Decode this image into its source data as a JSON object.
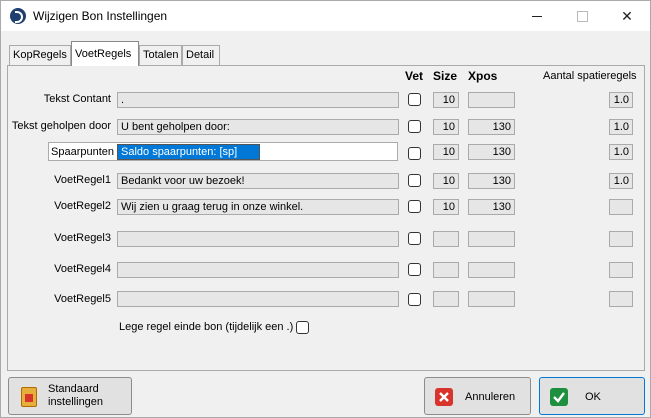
{
  "window": {
    "title": "Wijzigen Bon Instellingen"
  },
  "tabs": [
    {
      "label": "KopRegels"
    },
    {
      "label": "VoetRegels"
    },
    {
      "label": "Totalen"
    },
    {
      "label": "Detail"
    }
  ],
  "columns": {
    "vet": "Vet",
    "size": "Size",
    "xpos": "Xpos",
    "spacing": "Aantal spatieregels"
  },
  "rows": [
    {
      "label": "Tekst Contant",
      "text": ".",
      "size": "10",
      "xpos": "",
      "spacing": "1.0"
    },
    {
      "label": "Tekst geholpen door",
      "text": "U bent geholpen door:",
      "size": "10",
      "xpos": "130",
      "spacing": "1.0"
    },
    {
      "label": "Spaarpunten",
      "text": "Saldo spaarpunten: [sp]",
      "size": "10",
      "xpos": "130",
      "spacing": "1.0"
    },
    {
      "label": "VoetRegel1",
      "text": "Bedankt voor uw bezoek!",
      "size": "10",
      "xpos": "130",
      "spacing": "1.0"
    },
    {
      "label": "VoetRegel2",
      "text": "Wij zien u graag terug in onze winkel.",
      "size": "10",
      "xpos": "130",
      "spacing": ""
    },
    {
      "label": "VoetRegel3",
      "text": "",
      "size": "",
      "xpos": "",
      "spacing": ""
    },
    {
      "label": "VoetRegel4",
      "text": "",
      "size": "",
      "xpos": "",
      "spacing": ""
    },
    {
      "label": "VoetRegel5",
      "text": "",
      "size": "",
      "xpos": "",
      "spacing": ""
    }
  ],
  "options": {
    "lege_regel_label": "Lege regel einde bon (tijdelijk een .)"
  },
  "buttons": {
    "defaults_label": "Standaard\ninstellingen",
    "cancel_label": "Annuleren",
    "ok_label": "OK"
  },
  "colors": {
    "selection": "#0078d7",
    "cancel_icon": "#d9342b",
    "ok_icon": "#1e8f3e"
  }
}
